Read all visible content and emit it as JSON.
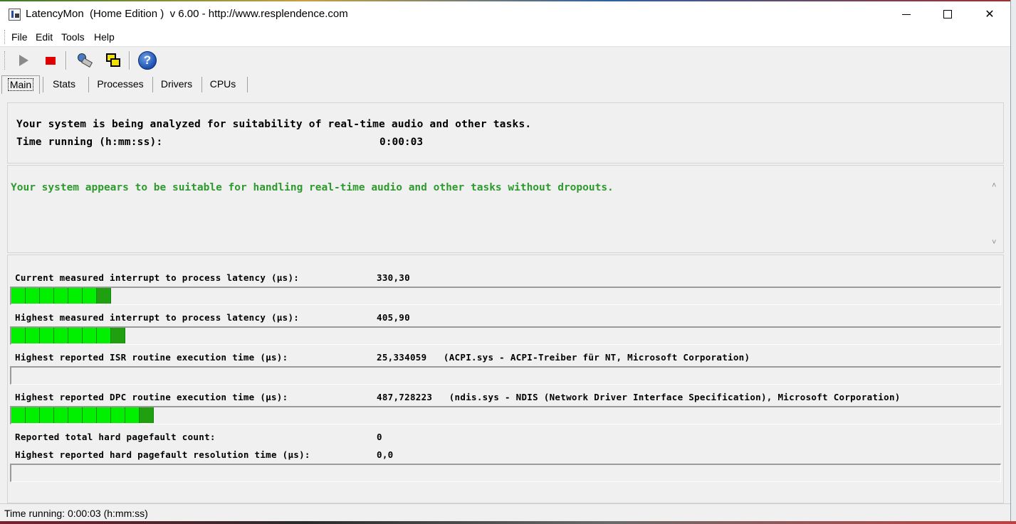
{
  "window": {
    "title": "LatencyMon  (Home Edition )  v 6.00 - http://www.resplendence.com"
  },
  "menu": {
    "file": "File",
    "edit": "Edit",
    "tools": "Tools",
    "help": "Help"
  },
  "toolbar": {
    "icons": [
      "play-icon",
      "stop-icon",
      "analyze-icon",
      "windows-icon",
      "help-icon"
    ],
    "help_glyph": "?"
  },
  "tabs": [
    {
      "label": "Main",
      "active": true
    },
    {
      "label": "Stats",
      "active": false
    },
    {
      "label": "Processes",
      "active": false
    },
    {
      "label": "Drivers",
      "active": false
    },
    {
      "label": "CPUs",
      "active": false
    }
  ],
  "analysis": {
    "line1": "Your system is being analyzed for suitability of real-time audio and other tasks.",
    "time_label": "Time running (h:mm:ss):",
    "time_value": "0:00:03"
  },
  "verdict": {
    "text": "Your system appears to be suitable for handling real-time audio and other tasks without dropouts.",
    "color": "#2e9a2e"
  },
  "metrics": {
    "current_latency": {
      "label": "Current measured interrupt to process latency (µs):",
      "value": "330,30",
      "segments": 7
    },
    "highest_latency": {
      "label": "Highest measured interrupt to process latency (µs):",
      "value": "405,90",
      "segments": 8
    },
    "isr": {
      "label": "Highest reported ISR routine execution time (µs):",
      "value": "25,334059   (ACPI.sys - ACPI-Treiber für NT, Microsoft Corporation)",
      "segments": 0
    },
    "dpc": {
      "label": "Highest reported DPC routine execution time (µs):",
      "value": "487,728223   (ndis.sys - NDIS (Network Driver Interface Specification), Microsoft Corporation)",
      "segments": 10
    },
    "pagefault_count": {
      "label": "Reported total hard pagefault count:",
      "value": "0"
    },
    "pagefault_time": {
      "label": "Highest reported hard pagefault resolution time (µs):",
      "value": "0,0",
      "segments": 0
    }
  },
  "status": {
    "text": "Time running: 0:00:03  (h:mm:ss)"
  },
  "colors": {
    "bar_light": "#00f000",
    "bar_dark": "#20a010",
    "verdict_green": "#2e9a2e"
  }
}
